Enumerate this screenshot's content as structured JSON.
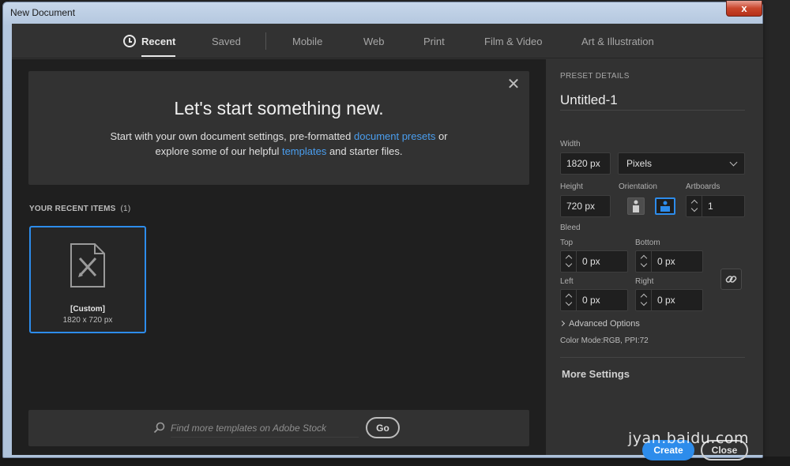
{
  "window": {
    "title": "New Document",
    "close_glyph": "x"
  },
  "tabs": [
    {
      "label": "Recent"
    },
    {
      "label": "Saved"
    },
    {
      "label": "Mobile"
    },
    {
      "label": "Web"
    },
    {
      "label": "Print"
    },
    {
      "label": "Film & Video"
    },
    {
      "label": "Art & Illustration"
    }
  ],
  "hero": {
    "title": "Let's start something new.",
    "line1_pre": "Start with your own document settings, pre-formatted ",
    "line1_link": "document presets",
    "line1_post": " or",
    "line2_pre": "explore some of our helpful ",
    "line2_link": "templates",
    "line2_post": " and starter files.",
    "close_glyph": "✕"
  },
  "recent": {
    "label": "YOUR RECENT ITEMS",
    "count": "(1)",
    "items": [
      {
        "name": "[Custom]",
        "size": "1820 x 720 px"
      }
    ]
  },
  "search": {
    "placeholder": "Find more templates on Adobe Stock",
    "go_label": "Go"
  },
  "preset": {
    "section_title": "PRESET DETAILS",
    "doc_name": "Untitled-1",
    "width_label": "Width",
    "width_value": "1820 px",
    "unit_value": "Pixels",
    "height_label": "Height",
    "height_value": "720 px",
    "orientation_label": "Orientation",
    "artboards_label": "Artboards",
    "artboards_value": "1",
    "bleed_label": "Bleed",
    "top_label": "Top",
    "top_value": "0 px",
    "bottom_label": "Bottom",
    "bottom_value": "0 px",
    "left_label": "Left",
    "left_value": "0 px",
    "right_label": "Right",
    "right_value": "0 px",
    "advanced_label": "Advanced Options",
    "color_mode": "Color Mode:RGB, PPI:72",
    "more_settings": "More Settings",
    "create_label": "Create",
    "close_label": "Close"
  },
  "watermark": "jyan.baidu.com",
  "colors": {
    "accent": "#2d8ceb",
    "link": "#4a9eef",
    "panel": "#323232",
    "canvas": "#1f1f1f"
  }
}
